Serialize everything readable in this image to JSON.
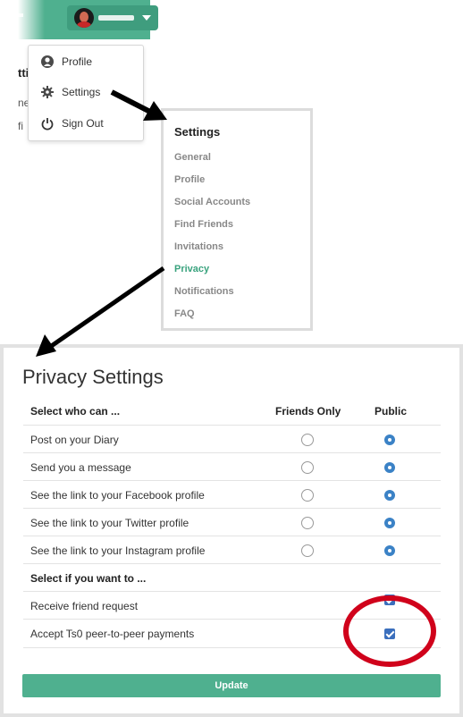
{
  "dropdown": {
    "items": [
      {
        "label": "Profile",
        "icon": "user-icon"
      },
      {
        "label": "Settings",
        "icon": "gear-icon"
      },
      {
        "label": "Sign Out",
        "icon": "power-icon"
      }
    ]
  },
  "settings_menu": {
    "title": "Settings",
    "links": [
      "General",
      "Profile",
      "Social Accounts",
      "Find Friends",
      "Invitations",
      "Privacy",
      "Notifications",
      "FAQ"
    ],
    "active": "Privacy"
  },
  "privacy": {
    "title": "Privacy Settings",
    "header_col1": "Select who can ...",
    "header_friends": "Friends Only",
    "header_public": "Public",
    "rows": [
      {
        "label": "Post on your Diary",
        "selected": "Public"
      },
      {
        "label": "Send you a message",
        "selected": "Public"
      },
      {
        "label": "See the link to your Facebook profile",
        "selected": "Public"
      },
      {
        "label": "See the link to your Twitter profile",
        "selected": "Public"
      },
      {
        "label": "See the link to your Instagram profile",
        "selected": "Public"
      }
    ],
    "section2_title": "Select if you want to ...",
    "options": [
      {
        "label": "Receive friend request",
        "checked": true
      },
      {
        "label": "Accept Ts0 peer-to-peer payments",
        "checked": true
      }
    ],
    "update_label": "Update"
  },
  "colors": {
    "brand": "#4fb08f",
    "active_link": "#3aa37e",
    "radio_selected": "#3b82c6",
    "annotation_circle": "#d0021b"
  }
}
